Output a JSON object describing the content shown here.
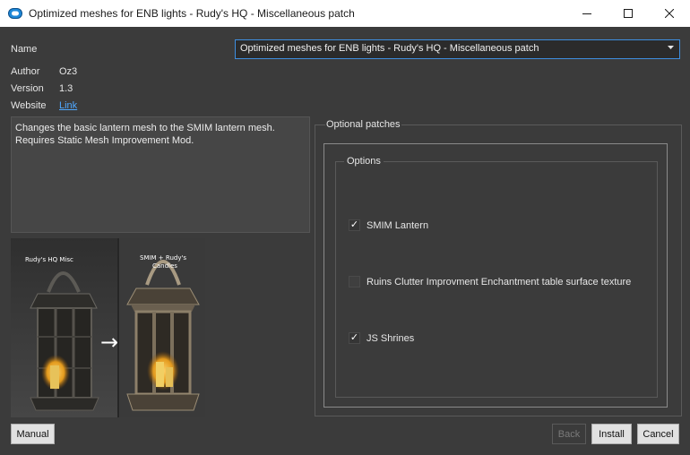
{
  "window": {
    "title": "Optimized meshes for ENB lights - Rudy's HQ - Miscellaneous patch"
  },
  "info": {
    "name_label": "Name",
    "name_value": "Optimized meshes for ENB lights - Rudy's HQ - Miscellaneous patch",
    "author_label": "Author",
    "author_value": "Oz3",
    "version_label": "Version",
    "version_value": "1.3",
    "website_label": "Website",
    "website_link": "Link"
  },
  "description": {
    "line1": "Changes the basic lantern mesh to the SMIM lantern mesh.",
    "line2": "Requires Static Mesh Improvement Mod."
  },
  "preview": {
    "left_caption": "Rudy's HQ Misc",
    "right_caption_line1": "SMIM + Rudy's",
    "right_caption_line2": "Candles",
    "arrow": "→"
  },
  "patches": {
    "group_title": "Optional patches",
    "options_title": "Options",
    "items": [
      {
        "label": "SMIM Lantern",
        "checked": true
      },
      {
        "label": "Ruins Clutter Improvment Enchantment table surface texture",
        "checked": false
      },
      {
        "label": "JS Shrines",
        "checked": true
      }
    ]
  },
  "buttons": {
    "manual": "Manual",
    "back": "Back",
    "install": "Install",
    "cancel": "Cancel"
  },
  "colors": {
    "background": "#3b3b3b",
    "accent": "#3e8ee0",
    "link": "#4fa8ff"
  }
}
